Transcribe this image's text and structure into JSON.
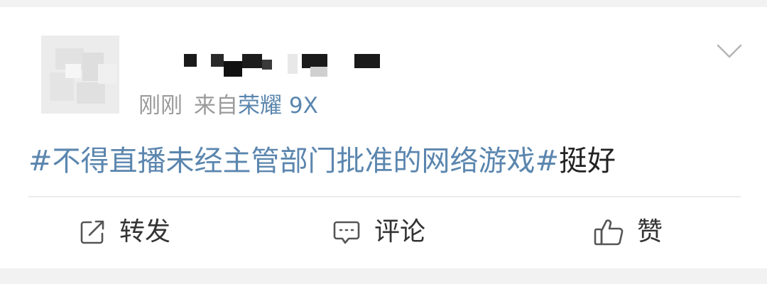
{
  "post": {
    "meta": {
      "time": "刚刚",
      "source_prefix": "来自",
      "device": "荣耀 9X"
    },
    "text": {
      "topic": "#不得直播未经主管部门批准的网络游戏#",
      "rest": "挺好"
    }
  },
  "actions": {
    "repost_label": "转发",
    "comment_label": "评论",
    "like_label": "赞"
  },
  "icons": {
    "menu": "chevron-down-icon",
    "repost": "repost-icon",
    "comment": "comment-icon",
    "like": "thumbs-up-icon"
  },
  "colors": {
    "link_blue": "#5b86ae",
    "meta_gray": "#9b9b9b",
    "text_dark": "#222222",
    "background": "#f2f2f2",
    "card": "#ffffff"
  }
}
